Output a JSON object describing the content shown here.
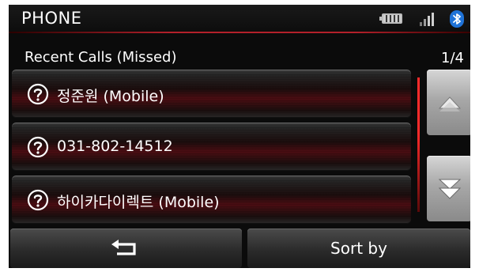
{
  "header": {
    "title": "PHONE",
    "status_icons": [
      "battery-icon",
      "signal-icon",
      "bluetooth-icon"
    ]
  },
  "list": {
    "heading": "Recent Calls (Missed)",
    "page_indicator": "1/4",
    "items": [
      {
        "icon": "question-circle-icon",
        "label": "정준원 (Mobile)"
      },
      {
        "icon": "question-circle-icon",
        "label": "031-802-14512"
      },
      {
        "icon": "question-circle-icon",
        "label": "하이카다이렉트 (Mobile)"
      }
    ]
  },
  "scroll": {
    "up_icon": "chevron-up-icon",
    "down_icon": "chevron-double-down-icon"
  },
  "footer": {
    "back_icon": "back-arrow-icon",
    "sort_label": "Sort by"
  },
  "colors": {
    "accent_red": "#b3202a",
    "bluetooth_blue": "#1f73d8"
  }
}
